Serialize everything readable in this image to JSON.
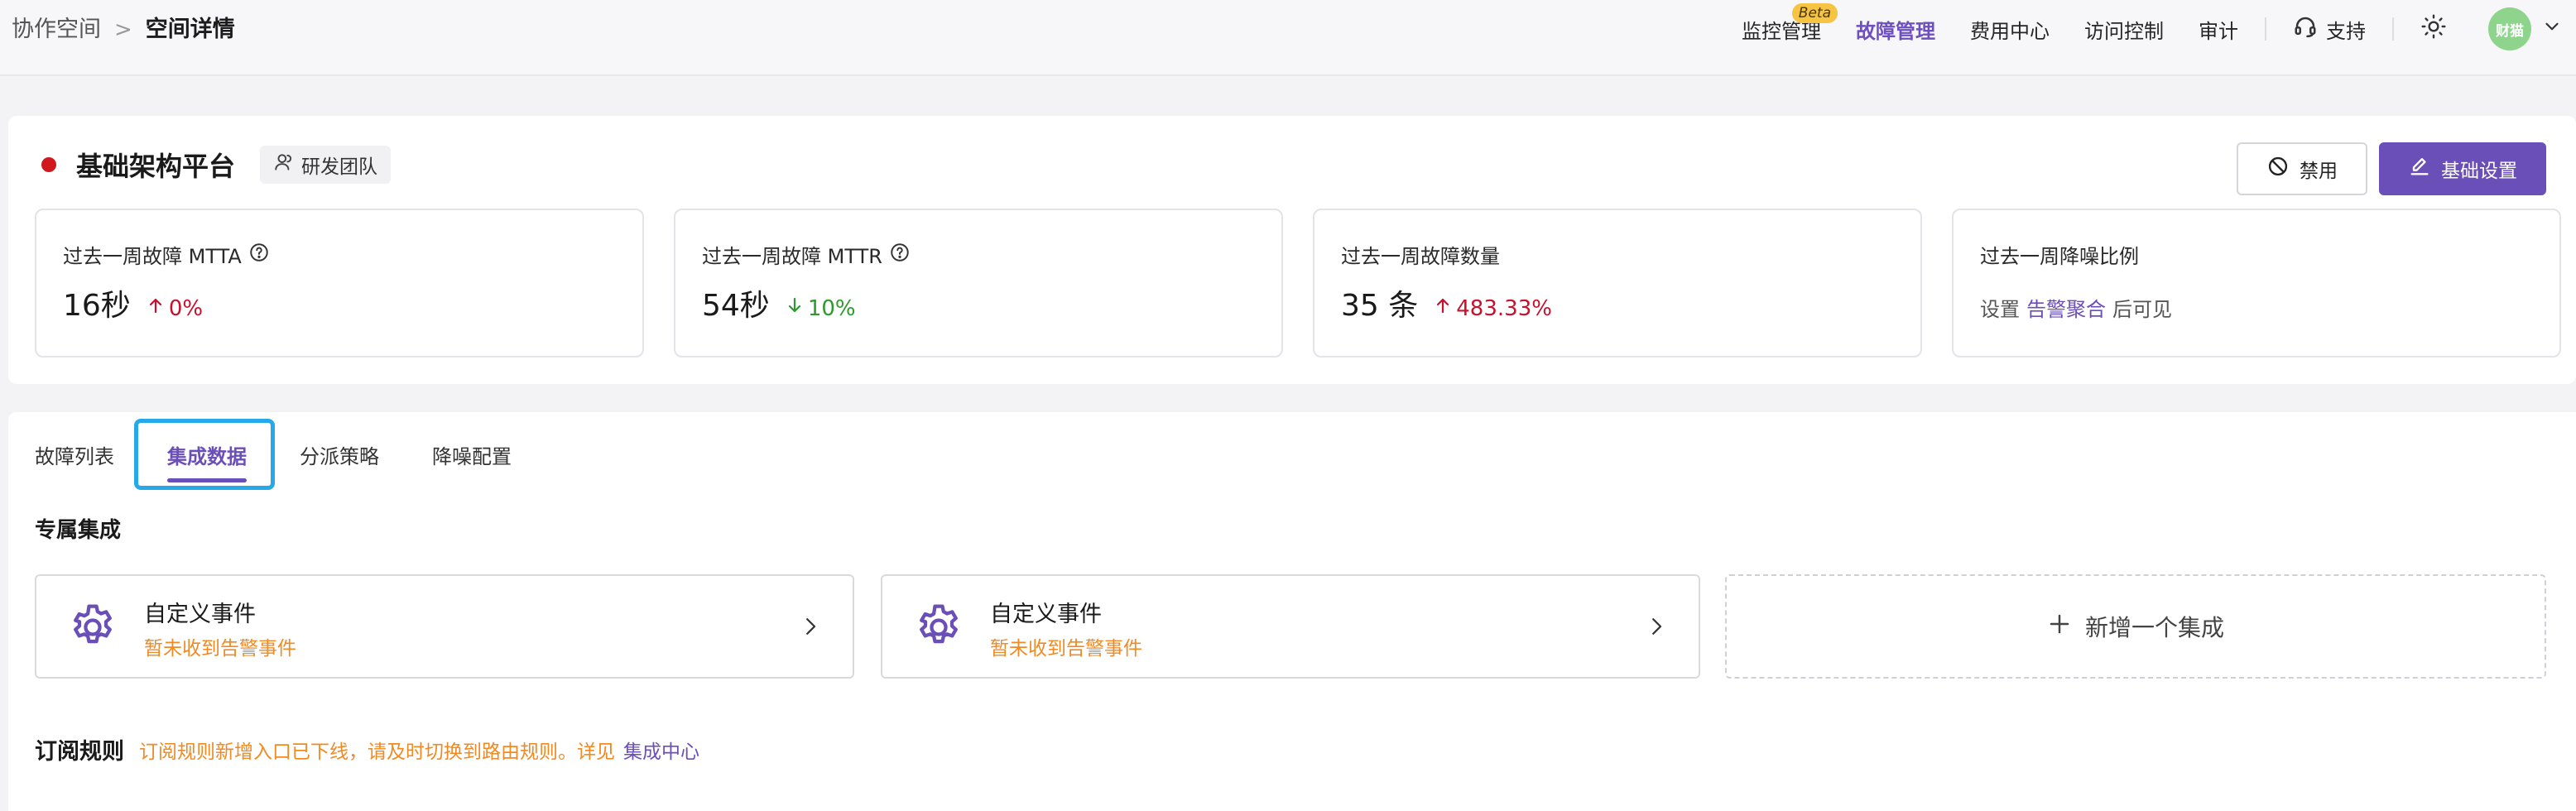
{
  "breadcrumb": {
    "parent": "协作空间",
    "separator": ">",
    "current": "空间详情"
  },
  "topnav": {
    "items": [
      {
        "label": "监控管理",
        "badge": "Beta",
        "active": false
      },
      {
        "label": "故障管理",
        "active": true
      },
      {
        "label": "费用中心",
        "active": false
      },
      {
        "label": "访问控制",
        "active": false
      },
      {
        "label": "审计",
        "active": false
      }
    ],
    "support_label": "支持",
    "avatar_text": "财猫"
  },
  "header": {
    "space_name": "基础架构平台",
    "status_color": "#d0191f",
    "team_tag": "研发团队",
    "disable_label": "禁用",
    "settings_label": "基础设置"
  },
  "stats": [
    {
      "title": "过去一周故障 MTTA",
      "value": "16秒",
      "trend": "0%",
      "trend_dir": "up"
    },
    {
      "title": "过去一周故障 MTTR",
      "value": "54秒",
      "trend": "10%",
      "trend_dir": "down"
    },
    {
      "title": "过去一周故障数量",
      "value": "35 条",
      "trend": "483.33%",
      "trend_dir": "up"
    },
    {
      "title": "过去一周降噪比例",
      "hint_prefix": "设置",
      "hint_link": "告警聚合",
      "hint_suffix": "后可见"
    }
  ],
  "tabs": [
    {
      "label": "故障列表",
      "active": false
    },
    {
      "label": "集成数据",
      "active": true
    },
    {
      "label": "分派策略",
      "active": false
    },
    {
      "label": "降噪配置",
      "active": false
    }
  ],
  "integrations": {
    "section_title": "专属集成",
    "cards": [
      {
        "name": "自定义事件",
        "status": "暂未收到告警事件",
        "icon": "gear-icon"
      },
      {
        "name": "自定义事件",
        "status": "暂未收到告警事件",
        "icon": "gear-icon"
      }
    ],
    "add_label": "新增一个集成"
  },
  "subscription": {
    "title": "订阅规则",
    "notice": "订阅规则新增入口已下线，请及时切换到路由规则。详见",
    "link": "集成中心"
  },
  "colors": {
    "accent": "#6b4fb8",
    "warning": "#f08a24",
    "trend_up": "#c8102e",
    "trend_down": "#2d9a2d",
    "focus_frame": "#26a9e8"
  }
}
